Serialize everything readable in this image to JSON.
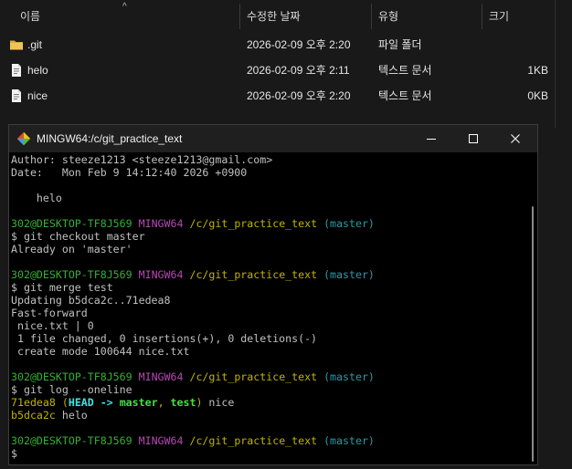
{
  "explorer": {
    "columns": {
      "name": "이름",
      "modified": "수정한 날짜",
      "type": "유형",
      "size": "크기"
    },
    "files": [
      {
        "name": ".git",
        "modified": "2026-02-09 오후 2:20",
        "type": "파일 폴더",
        "size": "",
        "icon": "folder-icon"
      },
      {
        "name": "helo",
        "modified": "2026-02-09 오후 2:11",
        "type": "텍스트 문서",
        "size": "1KB",
        "icon": "text-file-icon"
      },
      {
        "name": "nice",
        "modified": "2026-02-09 오후 2:20",
        "type": "텍스트 문서",
        "size": "0KB",
        "icon": "text-file-icon"
      }
    ]
  },
  "terminal": {
    "title": "MINGW64:/c/git_practice_text",
    "colors": {
      "prompt_user": "#34b034",
      "prompt_host": "#b548b5",
      "prompt_path": "#c0b300",
      "prompt_branch": "#2a9aa6"
    },
    "prompt": {
      "user": "302@DESKTOP-TF8J569",
      "host": "MINGW64",
      "path": "/c/git_practice_text",
      "branch": "(master)"
    },
    "lines": {
      "author": "Author: steeze1213 <steeze1213@gmail.com>",
      "date": "Date:   Mon Feb 9 14:12:40 2026 +0900",
      "msg": "    helo",
      "cmd1": "$ git checkout master",
      "out1": "Already on 'master'",
      "cmd2": "$ git merge test",
      "out2a": "Updating b5dca2c..71edea8",
      "out2b": "Fast-forward",
      "out2c": " nice.txt | 0",
      "out2d": " 1 file changed, 0 insertions(+), 0 deletions(-)",
      "out2e": " create mode 100644 nice.txt",
      "cmd3": "$ git log --oneline",
      "log1": {
        "hash": "71edea8",
        "open": " (",
        "head": "HEAD -> ",
        "master": "master",
        "comma": ", ",
        "test": "test",
        "close": ")",
        "msg": " nice"
      },
      "log2": {
        "hash": "b5dca2c",
        "msg": " helo"
      },
      "cursor": "$"
    }
  }
}
